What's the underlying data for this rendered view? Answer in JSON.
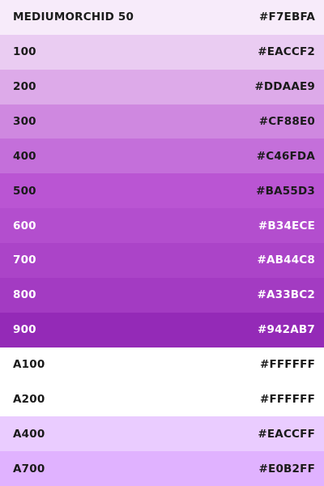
{
  "palette": {
    "swatches": [
      {
        "name": "MEDIUMORCHID 50",
        "hex": "#F7EBFA",
        "bg": "#F7EBFA",
        "text": "dark"
      },
      {
        "name": "100",
        "hex": "#EACCF2",
        "bg": "#EACCF2",
        "text": "dark"
      },
      {
        "name": "200",
        "hex": "#DDAAE9",
        "bg": "#DDAAE9",
        "text": "dark"
      },
      {
        "name": "300",
        "hex": "#CF88E0",
        "bg": "#CF88E0",
        "text": "dark"
      },
      {
        "name": "400",
        "hex": "#C46FDA",
        "bg": "#C46FDA",
        "text": "dark"
      },
      {
        "name": "500",
        "hex": "#BA55D3",
        "bg": "#BA55D3",
        "text": "dark"
      },
      {
        "name": "600",
        "hex": "#B34ECE",
        "bg": "#B34ECE",
        "text": "light"
      },
      {
        "name": "700",
        "hex": "#AB44C8",
        "bg": "#AB44C8",
        "text": "light"
      },
      {
        "name": "800",
        "hex": "#A33BC2",
        "bg": "#A33BC2",
        "text": "light"
      },
      {
        "name": "900",
        "hex": "#942AB7",
        "bg": "#942AB7",
        "text": "light"
      },
      {
        "name": "A100",
        "hex": "#FFFFFF",
        "bg": "#FFFFFF",
        "text": "dark"
      },
      {
        "name": "A200",
        "hex": "#FFFFFF",
        "bg": "#FFFFFF",
        "text": "dark"
      },
      {
        "name": "A400",
        "hex": "#EACCFF",
        "bg": "#EACCFF",
        "text": "dark"
      },
      {
        "name": "A700",
        "hex": "#E0B2FF",
        "bg": "#E0B2FF",
        "text": "dark"
      }
    ]
  }
}
